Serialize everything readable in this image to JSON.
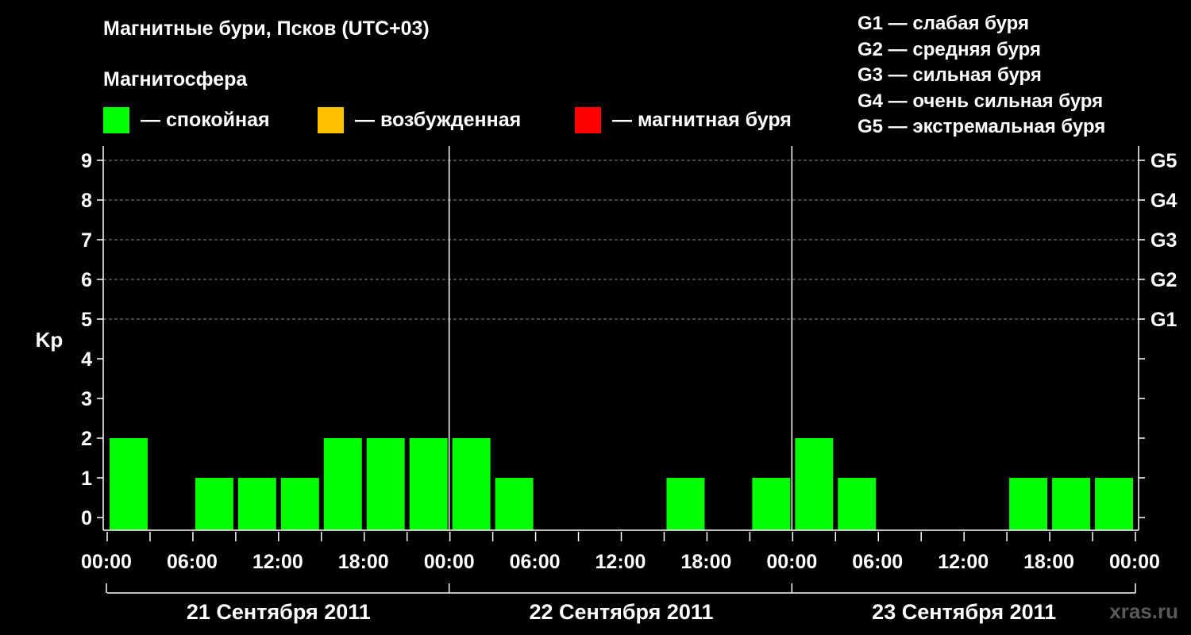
{
  "header": {
    "title": "Магнитные бури, Псков (UTC+03)",
    "subtitle": "Магнитосфера"
  },
  "legend": [
    {
      "label": "— спокойная",
      "color": "#00ff00"
    },
    {
      "label": "— возбужденная",
      "color": "#ffc000"
    },
    {
      "label": "— магнитная буря",
      "color": "#ff0000"
    }
  ],
  "storm_levels": [
    "G1 — слабая буря",
    "G2 — средняя буря",
    "G3 — сильная буря",
    "G4 — очень сильная буря",
    "G5 — экстремальная буря"
  ],
  "watermark": "xras.ru",
  "chart_data": {
    "type": "bar",
    "ylabel": "Kp",
    "ylim": [
      0,
      9
    ],
    "yticks": [
      "0",
      "1",
      "2",
      "3",
      "4",
      "5",
      "6",
      "7",
      "8",
      "9"
    ],
    "right_ticks": [
      {
        "value": 5,
        "label": "G1"
      },
      {
        "value": 6,
        "label": "G2"
      },
      {
        "value": 7,
        "label": "G3"
      },
      {
        "value": 8,
        "label": "G4"
      },
      {
        "value": 9,
        "label": "G5"
      }
    ],
    "grid": "dashed horizontal at 5–9",
    "x_tick_labels": [
      "00:00",
      "06:00",
      "12:00",
      "18:00",
      "00:00",
      "06:00",
      "12:00",
      "18:00",
      "00:00",
      "06:00",
      "12:00",
      "18:00",
      "00:00"
    ],
    "days": [
      "21 Сентября 2011",
      "22 Сентября 2011",
      "23 Сентября 2011"
    ],
    "intervals_per_day": 8,
    "interval_hours": 3,
    "values": [
      2,
      0,
      1,
      1,
      1,
      2,
      2,
      2,
      2,
      1,
      0,
      0,
      0,
      1,
      0,
      1,
      2,
      1,
      0,
      0,
      0,
      1,
      1,
      1
    ],
    "bar_color": "#00ff00"
  }
}
